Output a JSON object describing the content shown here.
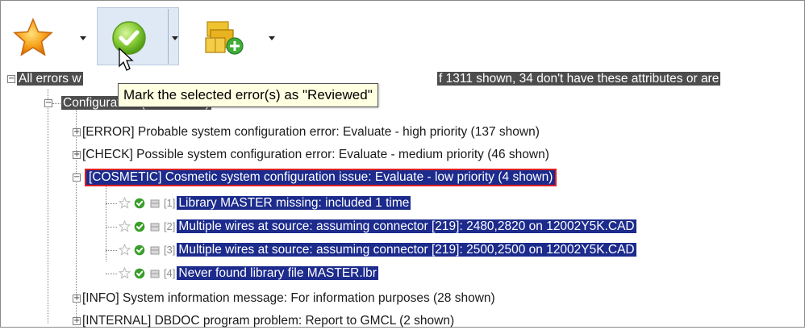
{
  "toolbar": {
    "buttons": [
      {
        "icon": "star-icon"
      },
      {
        "icon": "reviewed-check-icon"
      },
      {
        "icon": "package-add-icon"
      }
    ]
  },
  "tooltip": {
    "text": "Mark the selected error(s) as \"Reviewed\""
  },
  "tree": {
    "root": {
      "label_left": "All errors w",
      "label_right": "f 1311 shown, 34 don't have these attributes or are"
    },
    "configuration": {
      "label": "Configuration (217 shown)"
    },
    "categories": [
      {
        "label": "[ERROR] Probable system configuration error: Evaluate - high priority (137 shown)"
      },
      {
        "label": "[CHECK] Possible system configuration error: Evaluate - medium priority (46 shown)"
      },
      {
        "label": "[COSMETIC] Cosmetic system configuration issue: Evaluate - low priority (4 shown)"
      }
    ],
    "items": [
      {
        "index": "[1]",
        "label": "Library MASTER missing: included 1 time"
      },
      {
        "index": "[2]",
        "label": "Multiple wires at source: assuming connector [219]: 2480,2820 on 12002Y5K.CAD"
      },
      {
        "index": "[3]",
        "label": "Multiple wires at source: assuming connector [219]: 2500,2500 on 12002Y5K.CAD"
      },
      {
        "index": "[4]",
        "label": "Never found library file MASTER.lbr"
      }
    ],
    "more_categories": [
      {
        "label": "[INFO] System information message: For information purposes (28 shown)"
      },
      {
        "label": "[INTERNAL] DBDOC program problem: Report to GMCL (2 shown)"
      }
    ]
  },
  "colors": {
    "selection": "#1c2b8c",
    "highlight_outline": "#e02020",
    "tooltip_bg": "#ffffe1"
  }
}
